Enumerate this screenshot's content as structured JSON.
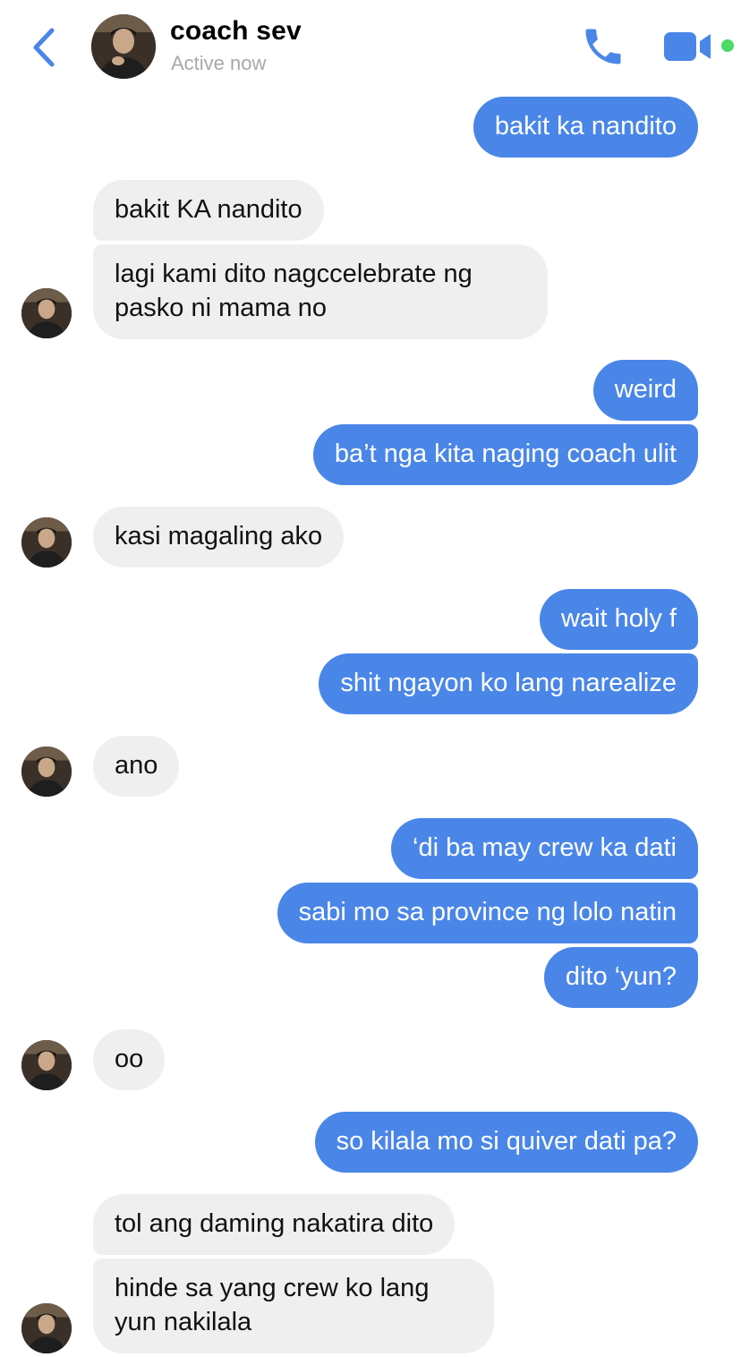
{
  "header": {
    "back_icon": "chevron-left-icon",
    "contact_name": "coach sev",
    "status": "Active now",
    "call_icon": "phone-icon",
    "video_icon": "video-camera-icon",
    "accent_color": "#4a86e8",
    "online_color": "#4cd964"
  },
  "messages": [
    {
      "from": "me",
      "text": "bakit ka nandito"
    },
    {
      "from": "coach sev",
      "text": "bakit KA nandito"
    },
    {
      "from": "coach sev",
      "text": "lagi kami dito nagccelebrate ng pasko ni mama no"
    },
    {
      "from": "me",
      "text": "weird"
    },
    {
      "from": "me",
      "text": "ba’t nga kita naging coach ulit"
    },
    {
      "from": "coach sev",
      "text": "kasi magaling ako"
    },
    {
      "from": "me",
      "text": "wait holy f"
    },
    {
      "from": "me",
      "text": "shit ngayon ko lang narealize"
    },
    {
      "from": "coach sev",
      "text": "ano"
    },
    {
      "from": "me",
      "text": "‘di ba may crew ka dati"
    },
    {
      "from": "me",
      "text": "sabi mo sa province ng lolo natin"
    },
    {
      "from": "me",
      "text": "dito ‘yun?"
    },
    {
      "from": "coach sev",
      "text": "oo"
    },
    {
      "from": "me",
      "text": "so kilala mo si quiver dati pa?"
    },
    {
      "from": "coach sev",
      "text": "tol ang daming nakatira dito"
    },
    {
      "from": "coach sev",
      "text": "hinde sa yang crew ko lang yun nakilala"
    }
  ],
  "colors": {
    "outgoing_bubble": "#4a86e8",
    "incoming_bubble": "#efefef"
  }
}
